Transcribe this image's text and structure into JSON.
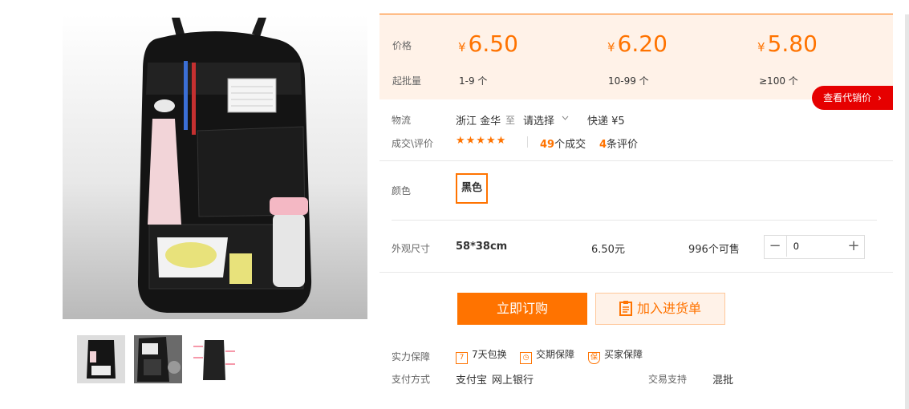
{
  "gallery": {
    "main_alt": "black car seat back organizer",
    "thumb_count": 3
  },
  "pricing": {
    "price_label": "价格",
    "moq_label": "起批量",
    "currency": "¥",
    "tiers": [
      {
        "price": "6.50",
        "range": "1-9 个"
      },
      {
        "price": "6.20",
        "range": "10-99 个"
      },
      {
        "price": "5.80",
        "range": "≥100 个"
      }
    ],
    "agent_button": "查看代销价",
    "agent_arrow": "›"
  },
  "logistics": {
    "label": "物流",
    "origin": "浙江 金华",
    "to": "至",
    "select": "请选择",
    "shipping": "快递 ¥5"
  },
  "reviews": {
    "label": "成交\\评价",
    "stars": "★★★★★",
    "deals_count": "49",
    "deals_suffix": "个成交",
    "review_count": "4",
    "review_suffix": "条评价",
    "rating": 5
  },
  "color": {
    "label": "颜色",
    "option": "黑色"
  },
  "spec": {
    "label": "外观尺寸",
    "size": "58*38cm",
    "price": "6.50元",
    "stock": "996个可售",
    "quantity": "0",
    "minus": "−",
    "plus": "+"
  },
  "actions": {
    "buy": "立即订购",
    "cart": "加入进货单"
  },
  "guarantee": {
    "label": "实力保障",
    "items": [
      "7天包换",
      "交期保障",
      "买家保障"
    ]
  },
  "payment": {
    "label": "支付方式",
    "methods": [
      "支付宝",
      "网上银行"
    ],
    "trade_label": "交易支持",
    "trade_value": "混批"
  },
  "colors": {
    "accent": "#ff7300",
    "panel": "#fff2e8",
    "red": "#e60000"
  }
}
